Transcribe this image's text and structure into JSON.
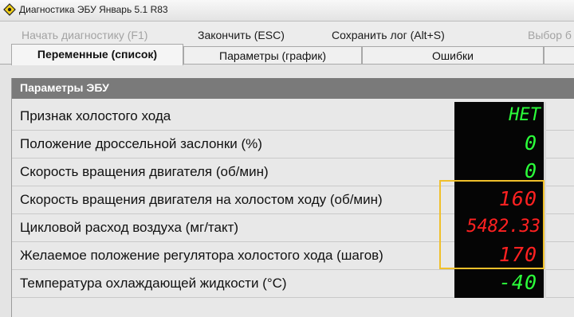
{
  "window": {
    "title": "Диагностика ЭБУ Январь 5.1 R83"
  },
  "menu": {
    "start": "Начать диагностику (F1)",
    "finish": "Закончить (ESC)",
    "save_log": "Сохранить лог (Alt+S)",
    "select": "Выбор б"
  },
  "tabs": [
    {
      "label": "Переменные (список)",
      "active": true
    },
    {
      "label": "Параметры (график)",
      "active": false
    },
    {
      "label": "Ошибки",
      "active": false
    }
  ],
  "panel": {
    "title": "Параметры ЭБУ",
    "rows": [
      {
        "label": "Признак холостого хода",
        "value": "НЕТ",
        "color": "#2bff3a"
      },
      {
        "label": "Положение дроссельной заслонки (%)",
        "value": "0",
        "color": "#2bff3a"
      },
      {
        "label": "Скорость вращения двигателя (об/мин)",
        "value": "0",
        "color": "#2bff3a"
      },
      {
        "label": "Скорость вращения двигателя на холостом ходу (об/мин)",
        "value": "160",
        "color": "#ff2121"
      },
      {
        "label": "Цикловой расход воздуха (мг/такт)",
        "value": "5482.33",
        "color": "#ff2121"
      },
      {
        "label": "Желаемое положение регулятора холостого хода (шагов)",
        "value": "170",
        "color": "#ff2121"
      },
      {
        "label": "Температура охлаждающей жидкости (°C)",
        "value": "-40",
        "color": "#2bff3a"
      }
    ]
  },
  "highlight_color": "#f0c02b"
}
